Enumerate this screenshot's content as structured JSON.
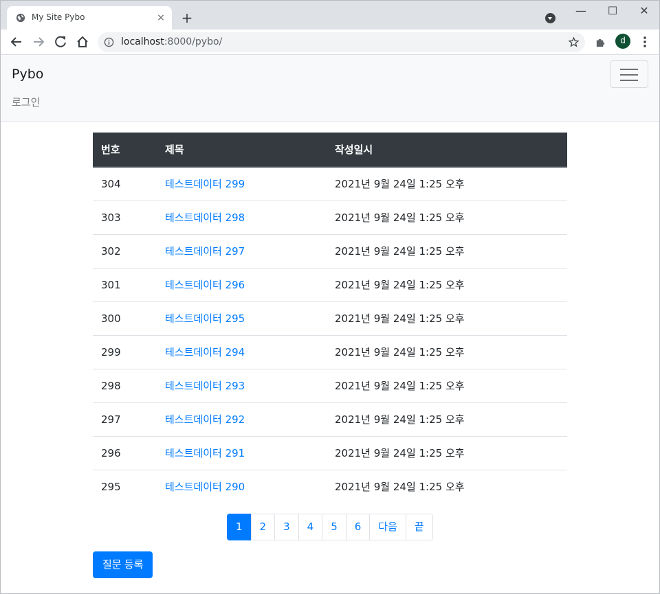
{
  "browser": {
    "tab_title": "My Site Pybo",
    "tab_close": "×",
    "new_tab": "+",
    "window_controls": {
      "minimize": "—",
      "maximize": "☐",
      "close": "✕"
    },
    "url_host": "localhost",
    "url_rest": ":8000/pybo/",
    "avatar_letter": "d",
    "icons": [
      "globe-icon",
      "back-arrow-icon",
      "forward-arrow-icon",
      "reload-icon",
      "home-icon",
      "info-icon",
      "star-icon",
      "puzzle-icon",
      "kebab-menu-icon"
    ]
  },
  "navbar": {
    "brand": "Pybo",
    "login": "로그인"
  },
  "table": {
    "headers": {
      "num": "번호",
      "subject": "제목",
      "created": "작성일시"
    },
    "rows": [
      {
        "num": "304",
        "subject": "테스트데이터 299",
        "created": "2021년 9월 24일 1:25 오후"
      },
      {
        "num": "303",
        "subject": "테스트데이터 298",
        "created": "2021년 9월 24일 1:25 오후"
      },
      {
        "num": "302",
        "subject": "테스트데이터 297",
        "created": "2021년 9월 24일 1:25 오후"
      },
      {
        "num": "301",
        "subject": "테스트데이터 296",
        "created": "2021년 9월 24일 1:25 오후"
      },
      {
        "num": "300",
        "subject": "테스트데이터 295",
        "created": "2021년 9월 24일 1:25 오후"
      },
      {
        "num": "299",
        "subject": "테스트데이터 294",
        "created": "2021년 9월 24일 1:25 오후"
      },
      {
        "num": "298",
        "subject": "테스트데이터 293",
        "created": "2021년 9월 24일 1:25 오후"
      },
      {
        "num": "297",
        "subject": "테스트데이터 292",
        "created": "2021년 9월 24일 1:25 오후"
      },
      {
        "num": "296",
        "subject": "테스트데이터 291",
        "created": "2021년 9월 24일 1:25 오후"
      },
      {
        "num": "295",
        "subject": "테스트데이터 290",
        "created": "2021년 9월 24일 1:25 오후"
      }
    ]
  },
  "pagination": {
    "pages": [
      "1",
      "2",
      "3",
      "4",
      "5",
      "6"
    ],
    "active": "1",
    "next": "다음",
    "last": "끝"
  },
  "actions": {
    "create_question": "질문 등록"
  },
  "colors": {
    "primary": "#007bff",
    "table_header": "#343a40",
    "navbar_bg": "#f8f9fa"
  }
}
